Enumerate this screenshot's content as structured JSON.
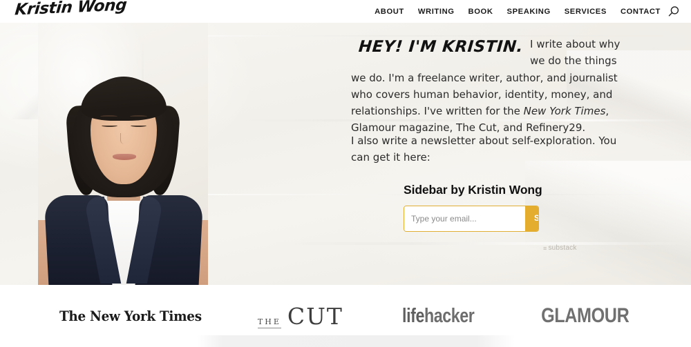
{
  "header": {
    "logo_text": "Kristin Wong",
    "nav": [
      {
        "label": "ABOUT"
      },
      {
        "label": "WRITING"
      },
      {
        "label": "BOOK"
      },
      {
        "label": "SPEAKING"
      },
      {
        "label": "SERVICES"
      },
      {
        "label": "CONTACT"
      }
    ],
    "search_icon": "search-icon"
  },
  "hero": {
    "headline": "HEY! I'M KRISTIN.",
    "paragraph1_part1": "I write about why we do the things we do. I'm a freelance writer, author, and journalist who covers human behavior, identity, money, and relationships. I've written for the ",
    "paragraph1_italic": "New York Times",
    "paragraph1_part2": ", Glamour magazine, The Cut, and Refinery29.",
    "paragraph2": "I also write a newsletter about self-exploration. You can get it here:",
    "photo_alt": "portrait-of-kristin-wong"
  },
  "subscribe": {
    "title": "Sidebar by Kristin Wong",
    "placeholder": "Type your email...",
    "button_label": "Subscribe",
    "attribution_mark": "≡",
    "attribution": "substack",
    "accent_color": "#e5ad2e"
  },
  "logo_bar": {
    "brands": [
      {
        "name": "The New York Times"
      },
      {
        "name_small": "THE",
        "name_large": "CUT"
      },
      {
        "name_strong": "life",
        "name_rest": "hacker"
      },
      {
        "name": "GLAMOUR"
      }
    ]
  }
}
